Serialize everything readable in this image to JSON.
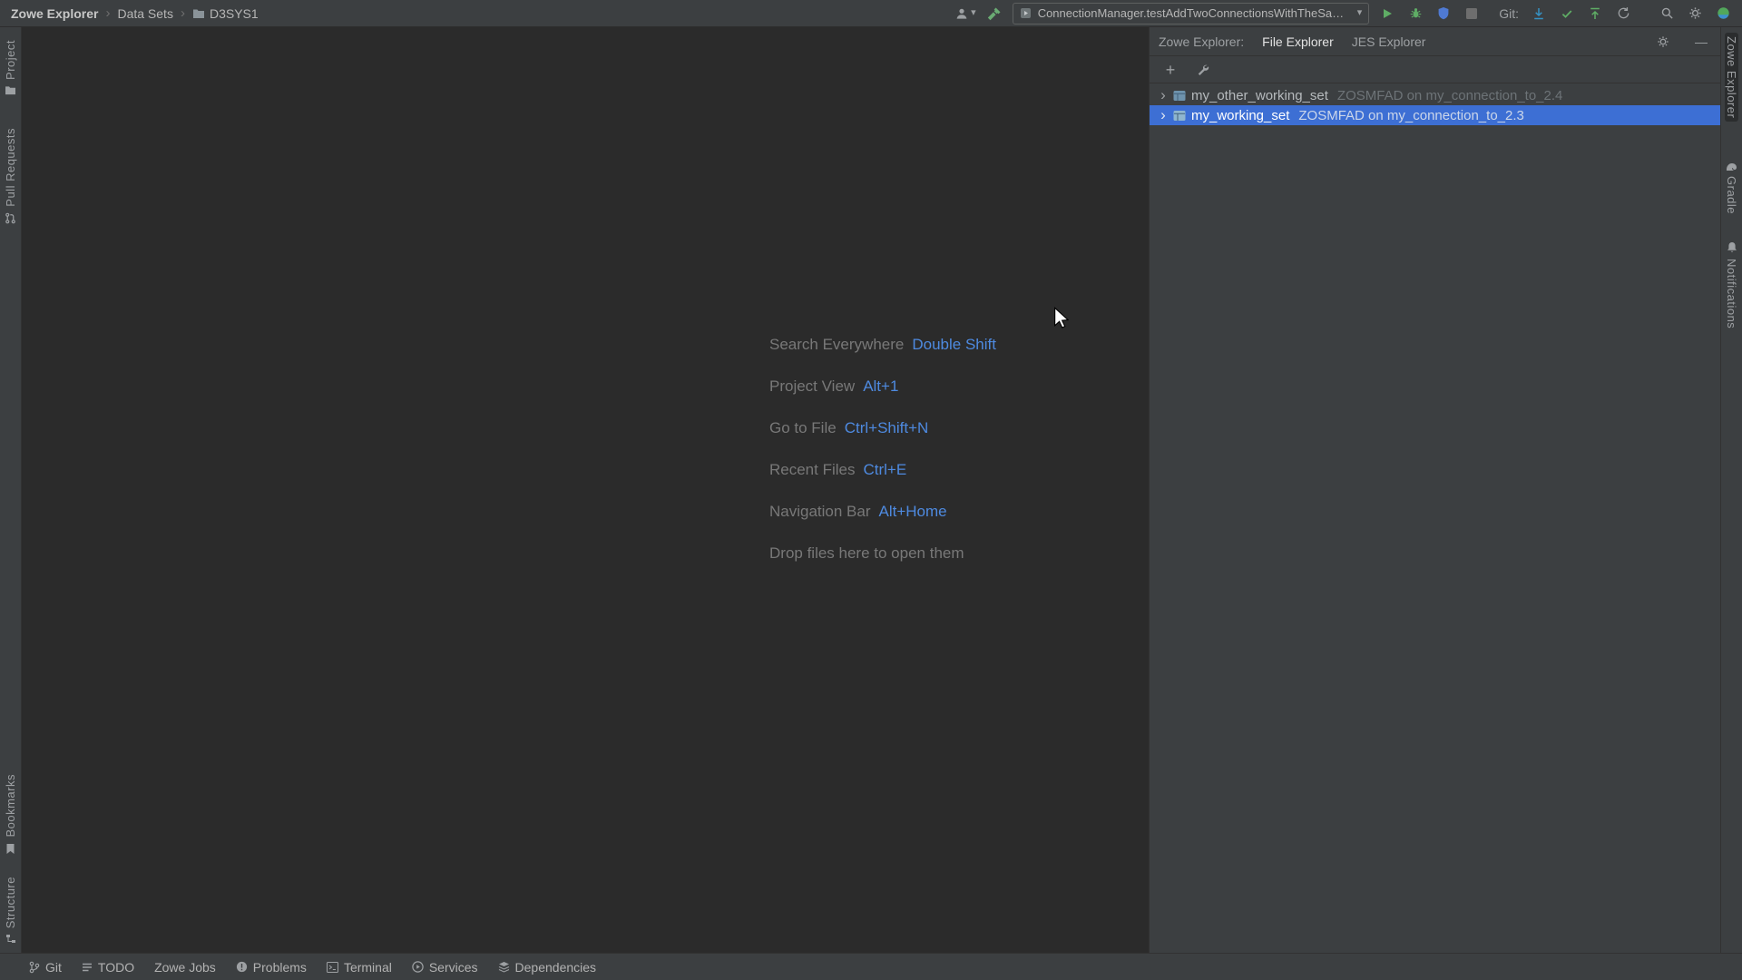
{
  "colors": {
    "accent": "#4e8ae0",
    "selection": "#3d6fd4",
    "run-green": "#5fad65",
    "git-blue": "#3592c4",
    "panel-bg": "#3c3f41",
    "editor-bg": "#2b2b2b",
    "border": "#323232",
    "text": "#bbbbbb",
    "dim-text": "#787878",
    "icon-gray": "#9da0a3"
  },
  "topbar": {
    "breadcrumbs": [
      "Zowe Explorer",
      "Data Sets",
      "D3SYS1"
    ],
    "run_config": "ConnectionManager.testAddTwoConnectionsWithTheSameName",
    "git_label": "Git:"
  },
  "icons": {
    "breadcrumb-separator": "›",
    "dropdown-arrow": "▾",
    "add": "+",
    "minimize": "—",
    "tree-chevron": "›"
  },
  "left_stripe": {
    "project": "Project",
    "pull_requests": "Pull Requests",
    "bookmarks": "Bookmarks",
    "structure": "Structure"
  },
  "right_stripe": {
    "zowe_explorer": "Zowe Explorer",
    "gradle": "Gradle",
    "notifications": "Notifications"
  },
  "editor": {
    "shortcuts": [
      {
        "label": "Search Everywhere",
        "keys": "Double Shift"
      },
      {
        "label": "Project View",
        "keys": "Alt+1"
      },
      {
        "label": "Go to File",
        "keys": "Ctrl+Shift+N"
      },
      {
        "label": "Recent Files",
        "keys": "Ctrl+E"
      },
      {
        "label": "Navigation Bar",
        "keys": "Alt+Home"
      }
    ],
    "drop_hint": "Drop files here to open them"
  },
  "tool_window": {
    "title": "Zowe Explorer:",
    "tabs": [
      {
        "label": "File Explorer",
        "active": true
      },
      {
        "label": "JES Explorer",
        "active": false
      }
    ],
    "tree": [
      {
        "name": "my_other_working_set",
        "detail": "ZOSMFAD on my_connection_to_2.4",
        "selected": false
      },
      {
        "name": "my_working_set",
        "detail": "ZOSMFAD on my_connection_to_2.3",
        "selected": true
      }
    ]
  },
  "statusbar": {
    "items": [
      "Git",
      "TODO",
      "Zowe Jobs",
      "Problems",
      "Terminal",
      "Services",
      "Dependencies"
    ]
  }
}
